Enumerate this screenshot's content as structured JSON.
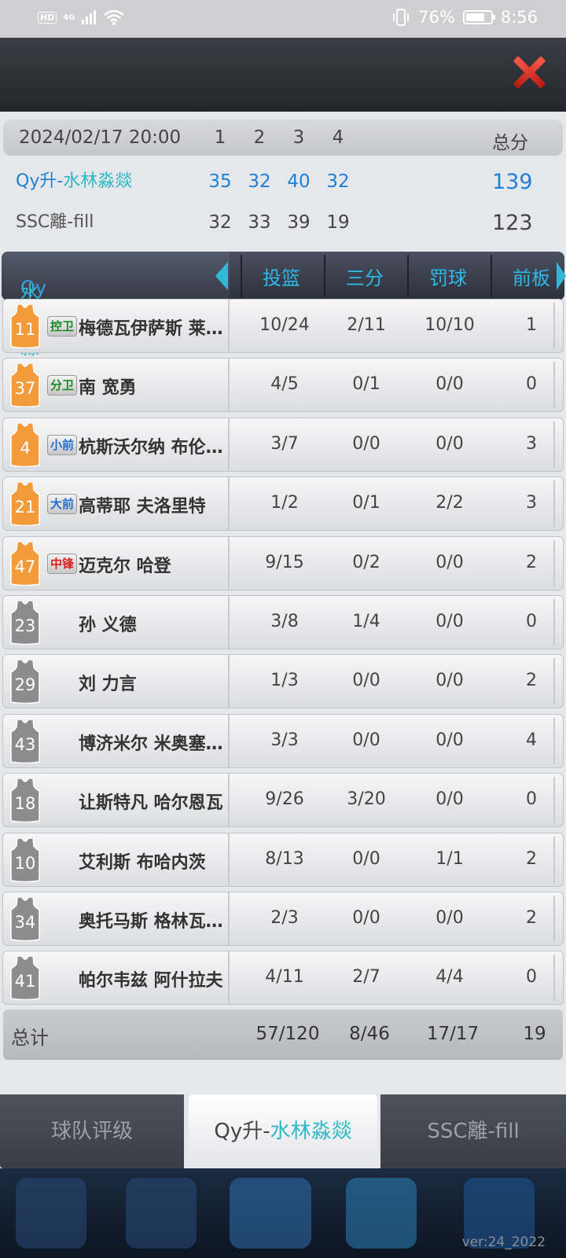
{
  "status_bar": {
    "hd": "HD",
    "network": "4G",
    "battery": "76%",
    "battery_level": 0.76,
    "time": "8:56"
  },
  "scoreboard": {
    "datetime": "2024/02/17 20:00",
    "quarters": [
      "1",
      "2",
      "3",
      "4"
    ],
    "total_label": "总分",
    "home": {
      "prefix": "Qy升-",
      "name": "水林淼燚",
      "scores": [
        "35",
        "32",
        "40",
        "32"
      ],
      "total": "139"
    },
    "away": {
      "name": "SSC離-fill",
      "scores": [
        "32",
        "33",
        "39",
        "19"
      ],
      "total": "123"
    }
  },
  "table": {
    "team_prefix": "Qy升-",
    "team_name": "水林淼燚",
    "headers": [
      "投篮",
      "三分",
      "罚球",
      "前板"
    ],
    "starters_color": "#f39a3a",
    "bench_color": "#8c8c8c",
    "players": [
      {
        "num": "11",
        "pos": "控卫",
        "pos_color": "#1a8a2a",
        "name": "梅德瓦伊萨斯 莱…",
        "fg": "10/24",
        "three": "2/11",
        "ft": "10/10",
        "oreb": "1",
        "starter": true
      },
      {
        "num": "37",
        "pos": "分卫",
        "pos_color": "#1a8a2a",
        "name": "南 宽勇",
        "fg": "4/5",
        "three": "0/1",
        "ft": "0/0",
        "oreb": "0",
        "starter": true
      },
      {
        "num": "4",
        "pos": "小前",
        "pos_color": "#1e6fd0",
        "name": "杭斯沃尔纳 布伦…",
        "fg": "3/7",
        "three": "0/0",
        "ft": "0/0",
        "oreb": "3",
        "starter": true
      },
      {
        "num": "21",
        "pos": "大前",
        "pos_color": "#1e6fd0",
        "name": "高蒂耶 夫洛里特",
        "fg": "1/2",
        "three": "0/1",
        "ft": "2/2",
        "oreb": "3",
        "starter": true
      },
      {
        "num": "47",
        "pos": "中锋",
        "pos_color": "#d8201a",
        "name": "迈克尔 哈登",
        "fg": "9/15",
        "three": "0/2",
        "ft": "0/0",
        "oreb": "2",
        "starter": true
      },
      {
        "num": "23",
        "pos": "",
        "pos_color": "",
        "name": "孙 义德",
        "fg": "3/8",
        "three": "1/4",
        "ft": "0/0",
        "oreb": "0",
        "starter": false
      },
      {
        "num": "29",
        "pos": "",
        "pos_color": "",
        "name": "刘 力言",
        "fg": "1/3",
        "three": "0/0",
        "ft": "0/0",
        "oreb": "2",
        "starter": false
      },
      {
        "num": "43",
        "pos": "",
        "pos_color": "",
        "name": "博济米尔 米奥塞…",
        "fg": "3/3",
        "three": "0/0",
        "ft": "0/0",
        "oreb": "4",
        "starter": false
      },
      {
        "num": "18",
        "pos": "",
        "pos_color": "",
        "name": "让斯特凡 哈尔恩瓦",
        "fg": "9/26",
        "three": "3/20",
        "ft": "0/0",
        "oreb": "0",
        "starter": false
      },
      {
        "num": "10",
        "pos": "",
        "pos_color": "",
        "name": "艾利斯 布哈内茨",
        "fg": "8/13",
        "three": "0/0",
        "ft": "1/1",
        "oreb": "2",
        "starter": false
      },
      {
        "num": "34",
        "pos": "",
        "pos_color": "",
        "name": "奥托马斯 格林瓦…",
        "fg": "2/3",
        "three": "0/0",
        "ft": "0/0",
        "oreb": "2",
        "starter": false
      },
      {
        "num": "41",
        "pos": "",
        "pos_color": "",
        "name": "帕尔韦兹 阿什拉夫",
        "fg": "4/11",
        "three": "2/7",
        "ft": "4/4",
        "oreb": "0",
        "starter": false
      }
    ],
    "totals": {
      "label": "总计",
      "fg": "57/120",
      "three": "8/46",
      "ft": "17/17",
      "oreb": "19"
    }
  },
  "tabs": {
    "rating": "球队评级",
    "home_prefix": "Qy升-",
    "home_name": "水林淼燚",
    "away": "SSC離-fill"
  },
  "version": "ver:24_2022"
}
